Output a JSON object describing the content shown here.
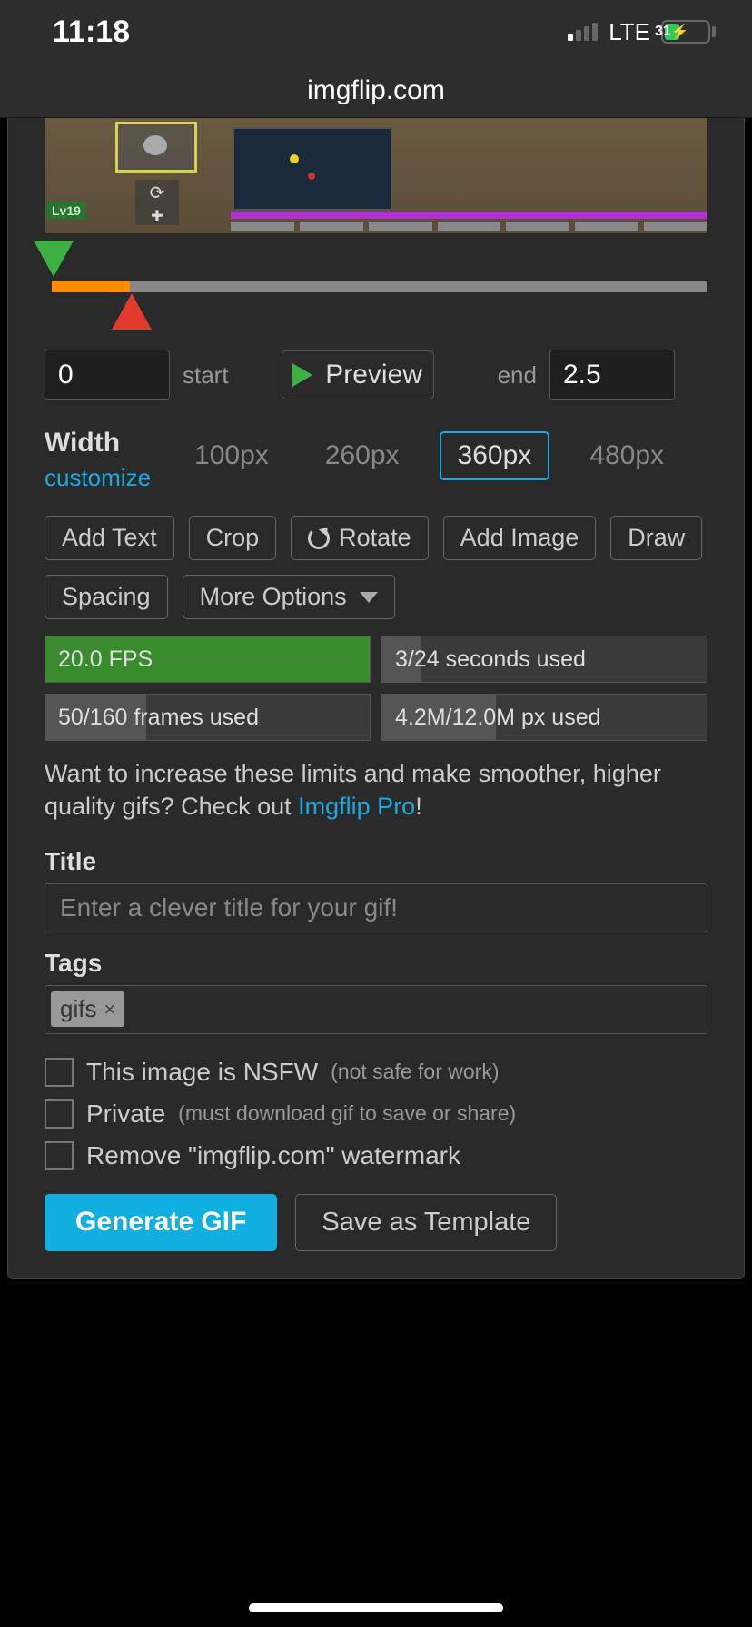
{
  "status": {
    "time": "11:18",
    "network": "LTE",
    "battery": "31"
  },
  "url": "imgflip.com",
  "videoPreview": {
    "levelBadge": "Lv19"
  },
  "timeline": {
    "start_value": "0",
    "start_label": "start",
    "end_value": "2.5",
    "end_label": "end",
    "preview_label": "Preview"
  },
  "width": {
    "label": "Width",
    "customize": "customize",
    "options": [
      "100px",
      "260px",
      "360px",
      "480px"
    ],
    "selected": "360px"
  },
  "tools": {
    "add_text": "Add Text",
    "crop": "Crop",
    "rotate": "Rotate",
    "add_image": "Add Image",
    "draw": "Draw",
    "spacing": "Spacing",
    "more_options": "More Options"
  },
  "stats": {
    "fps": {
      "text": "20.0 FPS",
      "fill_pct": 100
    },
    "seconds": {
      "text": "3/24 seconds used",
      "fill_pct": 12
    },
    "frames": {
      "text": "50/160 frames used",
      "fill_pct": 31
    },
    "px": {
      "text": "4.2M/12.0M px used",
      "fill_pct": 35
    }
  },
  "promo": {
    "prefix": "Want to increase these limits and make smoother, higher quality gifs? Check out ",
    "link": "Imgflip Pro",
    "suffix": "!"
  },
  "title": {
    "label": "Title",
    "placeholder": "Enter a clever title for your gif!"
  },
  "tags": {
    "label": "Tags",
    "chip": "gifs"
  },
  "checks": {
    "nsfw_main": "This image is NSFW",
    "nsfw_note": "(not safe for work)",
    "private_main": "Private",
    "private_note": "(must download gif to save or share)",
    "watermark": "Remove \"imgflip.com\" watermark"
  },
  "actions": {
    "generate": "Generate GIF",
    "save_template": "Save as Template"
  }
}
